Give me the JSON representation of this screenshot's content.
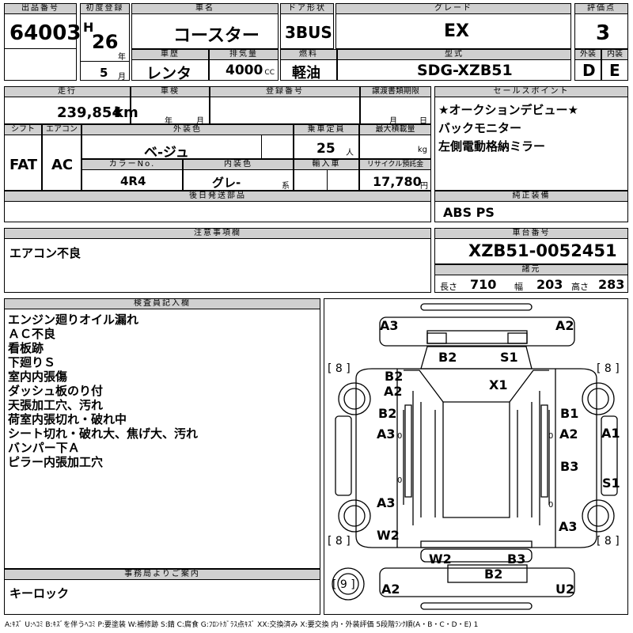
{
  "top": {
    "lot_no_label": "出品番号",
    "lot_no": "64003",
    "first_reg_label": "初度登録",
    "era": "H",
    "year": "26",
    "year_unit": "年",
    "month": "5",
    "month_unit": "月",
    "car_name_label": "車名",
    "car_name": "コースター",
    "door_label": "ドア形状",
    "door": "3BUS",
    "grade_label": "グレード",
    "grade": "EX",
    "score_label": "評価点",
    "score": "3",
    "history_label": "車歴",
    "history": "レンタ",
    "displacement_label": "排気量",
    "displacement": "4000",
    "displacement_unit": "CC",
    "fuel_label": "燃料",
    "fuel": "軽油",
    "model_label": "型式",
    "model": "SDG-XZB51",
    "exterior_label": "外装",
    "exterior": "D",
    "interior_label": "内装",
    "interior": "E"
  },
  "mid": {
    "mileage_label": "走行",
    "mileage": "239,854",
    "mileage_unit": "km",
    "inspection_label": "車検",
    "inspection_year_unit": "年",
    "inspection_month_unit": "月",
    "reg_no_label": "登録番号",
    "transfer_label": "譲渡書類期限",
    "transfer_month_unit": "月",
    "transfer_day_unit": "日",
    "shift_label": "シフト",
    "shift": "FAT",
    "ac_label": "エアコン",
    "ac": "AC",
    "ext_color_label": "外装色",
    "ext_color": "ベ-ジュ",
    "capacity_label": "乗車定員",
    "capacity": "25",
    "capacity_unit": "人",
    "max_load_label": "最大積載量",
    "max_load_unit": "kg",
    "color_no_label": "カラーNo.",
    "color_no": "4R4",
    "int_color_label": "内装色",
    "int_color": "グレ-",
    "int_color_unit": "系",
    "import_label": "輸入車",
    "recycle_label": "リサイクル預託金",
    "recycle": "17,780",
    "recycle_unit": "円",
    "later_parts_label": "後日発送部品",
    "sales_label": "セールスポイント",
    "sales_points": [
      "★オークションデビュー★",
      "バックモニター",
      "左側電動格納ミラー"
    ],
    "genuine_label": "純正装備",
    "genuine": "ABS PS",
    "notes_label": "注意事項欄",
    "notes": "エアコン不良",
    "chassis_label": "車台番号",
    "chassis": "XZB51-0052451",
    "spec_label": "諸元",
    "length_label": "長さ",
    "length": "710",
    "width_label": "幅",
    "width": "203",
    "height_label": "高さ",
    "height": "283"
  },
  "inspector": {
    "label": "検査員記入欄",
    "lines": [
      "エンジン廻りオイル漏れ",
      "ＡＣ不良",
      "看板跡",
      "下廻りＳ",
      "室内内張傷",
      "ダッシュ板のり付",
      "天張加工穴、汚れ",
      "荷室内張切れ・破れ中",
      "シート切れ・破れ大、焦げ大、汚れ",
      "バンパー下Ａ",
      "ピラー内張加工穴"
    ]
  },
  "office": {
    "label": "事務局よりご案内",
    "note": "キーロック"
  },
  "diagram": {
    "marks": {
      "front_left": "A3",
      "front_right": "A2",
      "hood_left": "B2",
      "hood_right": "S1",
      "left_front_door_1": "B2",
      "left_front_door_2": "A2",
      "roof": "X1",
      "left_b": "B2",
      "left_a": "A3",
      "right_b": "B1",
      "right_a": "A2",
      "right_side_a": "A1",
      "right_mid": "B3",
      "right_side_s": "S1",
      "left_rear_a": "A3",
      "left_w": "W2",
      "right_rear_a": "A3",
      "rear_w": "W2",
      "rear_b3": "B3",
      "rear_b2": "B2",
      "rear_left": "A2",
      "rear_right": "U2",
      "small_o1": "0",
      "small_o2": "0",
      "small_o3": "0",
      "small_o4": "0"
    },
    "tires": {
      "front_left": "8",
      "front_right": "8",
      "rear_left": "8",
      "rear_right": "8",
      "spare": "9"
    }
  },
  "legend": "A:ｷｽﾞ U:ﾍｺﾐ B:ｷｽﾞを伴うﾍｺﾐ P:要塗装 W:補修跡 S:錆 C:腐食 G:ﾌﾛﾝﾄｶﾞﾗｽ点ｷｽﾞ XX:交換済み X:要交換 内・外装評価 5段階ﾗﾝｸ順(A・B・C・D・E) 1"
}
